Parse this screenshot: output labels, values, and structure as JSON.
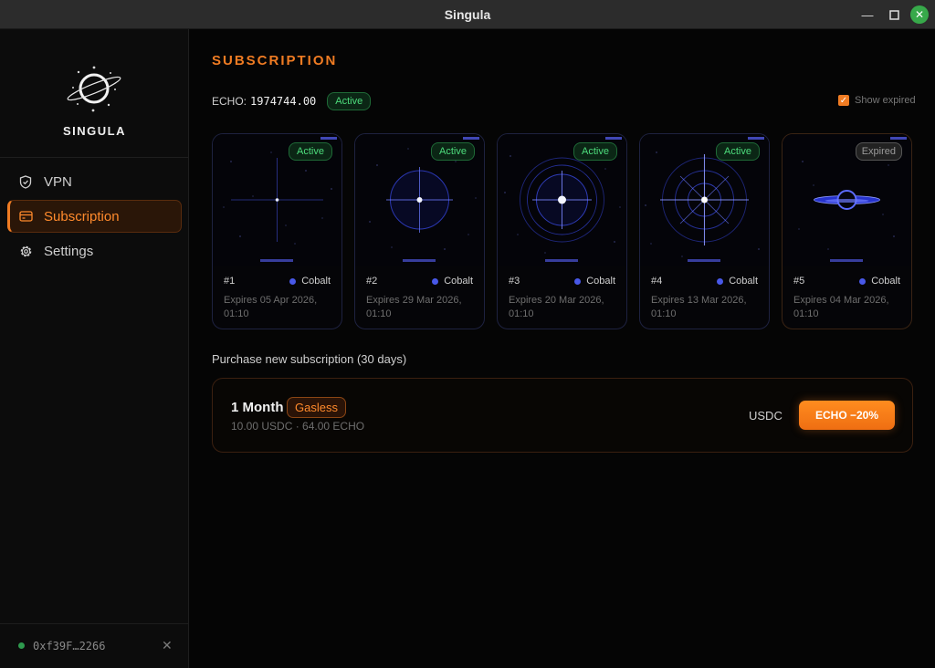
{
  "window": {
    "title": "Singula"
  },
  "sidebar": {
    "brand": "SINGULA",
    "items": [
      {
        "label": "VPN",
        "icon": "shield-icon"
      },
      {
        "label": "Subscription",
        "icon": "card-icon",
        "active": true
      },
      {
        "label": "Settings",
        "icon": "gear-icon"
      }
    ],
    "wallet": "0xf39F…2266"
  },
  "main": {
    "heading": "SUBSCRIPTION",
    "echo_label": "ECHO:",
    "echo_balance": "1974744.00",
    "echo_status": "Active",
    "show_expired_label": "Show expired",
    "show_expired_checked": true,
    "cards": [
      {
        "number": "#1",
        "status": "Active",
        "plan": "Cobalt",
        "expires": "Expires 05 Apr 2026, 01:10"
      },
      {
        "number": "#2",
        "status": "Active",
        "plan": "Cobalt",
        "expires": "Expires 29 Mar 2026, 01:10"
      },
      {
        "number": "#3",
        "status": "Active",
        "plan": "Cobalt",
        "expires": "Expires 20 Mar 2026, 01:10"
      },
      {
        "number": "#4",
        "status": "Active",
        "plan": "Cobalt",
        "expires": "Expires 13 Mar 2026, 01:10"
      },
      {
        "number": "#5",
        "status": "Expired",
        "plan": "Cobalt",
        "expires": "Expires 04 Mar 2026, 01:10"
      }
    ],
    "purchase_label": "Purchase new subscription (30 days)",
    "plan": {
      "title": "1 Month",
      "tag": "Gasless",
      "price": "10.00 USDC · 64.00 ECHO",
      "usdc_option": "USDC",
      "echo_button": "ECHO −20%"
    }
  },
  "colors": {
    "accent": "#f07c23",
    "active_green": "#4ddc7c",
    "cobalt": "#4858e8"
  }
}
